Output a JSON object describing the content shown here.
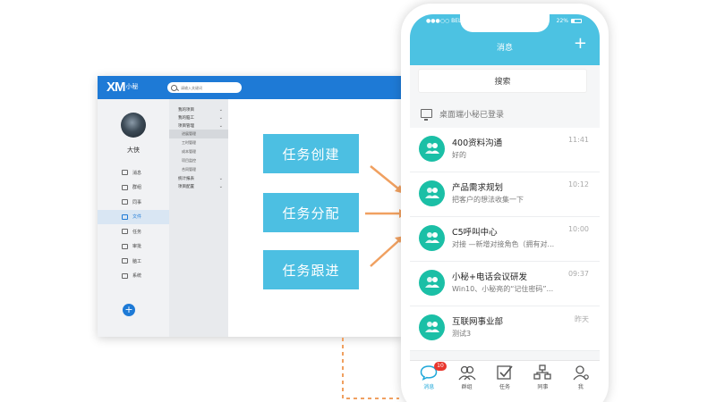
{
  "desktop": {
    "logo_main": "XM",
    "logo_sub": "小秘",
    "search_placeholder": "请输入关键词",
    "user_name": "大侠",
    "nav": [
      {
        "label": "消息",
        "icon": "message-icon"
      },
      {
        "label": "群组",
        "icon": "group-icon"
      },
      {
        "label": "同事",
        "icon": "colleague-icon"
      },
      {
        "label": "文件",
        "icon": "file-icon",
        "active": true
      },
      {
        "label": "任务",
        "icon": "task-icon"
      },
      {
        "label": "审批",
        "icon": "approval-icon"
      },
      {
        "label": "脑工",
        "icon": "work-icon"
      },
      {
        "label": "系统",
        "icon": "system-icon"
      }
    ],
    "add_label": "+",
    "menu": {
      "my_items": "我的项目",
      "my_work": "我的脑工",
      "project_mgmt": "项目管理",
      "sub_items": [
        {
          "label": "进展管理",
          "active": true
        },
        {
          "label": "工时管理"
        },
        {
          "label": "成本管理"
        },
        {
          "label": "项目监控"
        },
        {
          "label": "合同管理"
        }
      ],
      "stats_report": "统计报表",
      "project_config": "项目配置"
    }
  },
  "tasks": [
    "任务创建",
    "任务分配",
    "任务跟进"
  ],
  "phone": {
    "carrier": "BELL",
    "battery": "22%",
    "title": "消息",
    "plus": "+",
    "search_label": "搜索",
    "login_notice": "桌面端小秘已登录",
    "conversations": [
      {
        "name": "400资料沟通",
        "msg": "好的",
        "time": "11:41"
      },
      {
        "name": "产品需求规划",
        "msg": "把客户的想法收集一下",
        "time": "10:12"
      },
      {
        "name": "C5呼叫中心",
        "msg": "对接 —新增对接角色（拥有对...",
        "time": "10:00"
      },
      {
        "name": "小秘+电话会议研发",
        "msg": "Win10、小秘亮的“记住密码”...",
        "time": "09:37"
      },
      {
        "name": "互联网事业部",
        "msg": "测试3",
        "time": "昨天"
      }
    ],
    "tabs": [
      {
        "label": "消息",
        "icon": "message-icon",
        "active": true,
        "badge": "10"
      },
      {
        "label": "群组",
        "icon": "group-icon"
      },
      {
        "label": "任务",
        "icon": "task-icon"
      },
      {
        "label": "同事",
        "icon": "colleague-icon"
      },
      {
        "label": "我",
        "icon": "me-icon"
      }
    ]
  },
  "colors": {
    "desktop_header": "#1e7ad6",
    "task_button": "#4cbfe2",
    "phone_header": "#4cc2e2",
    "avatar": "#1bbfa6",
    "arrow": "#f0a060",
    "badge": "#e8362d"
  }
}
